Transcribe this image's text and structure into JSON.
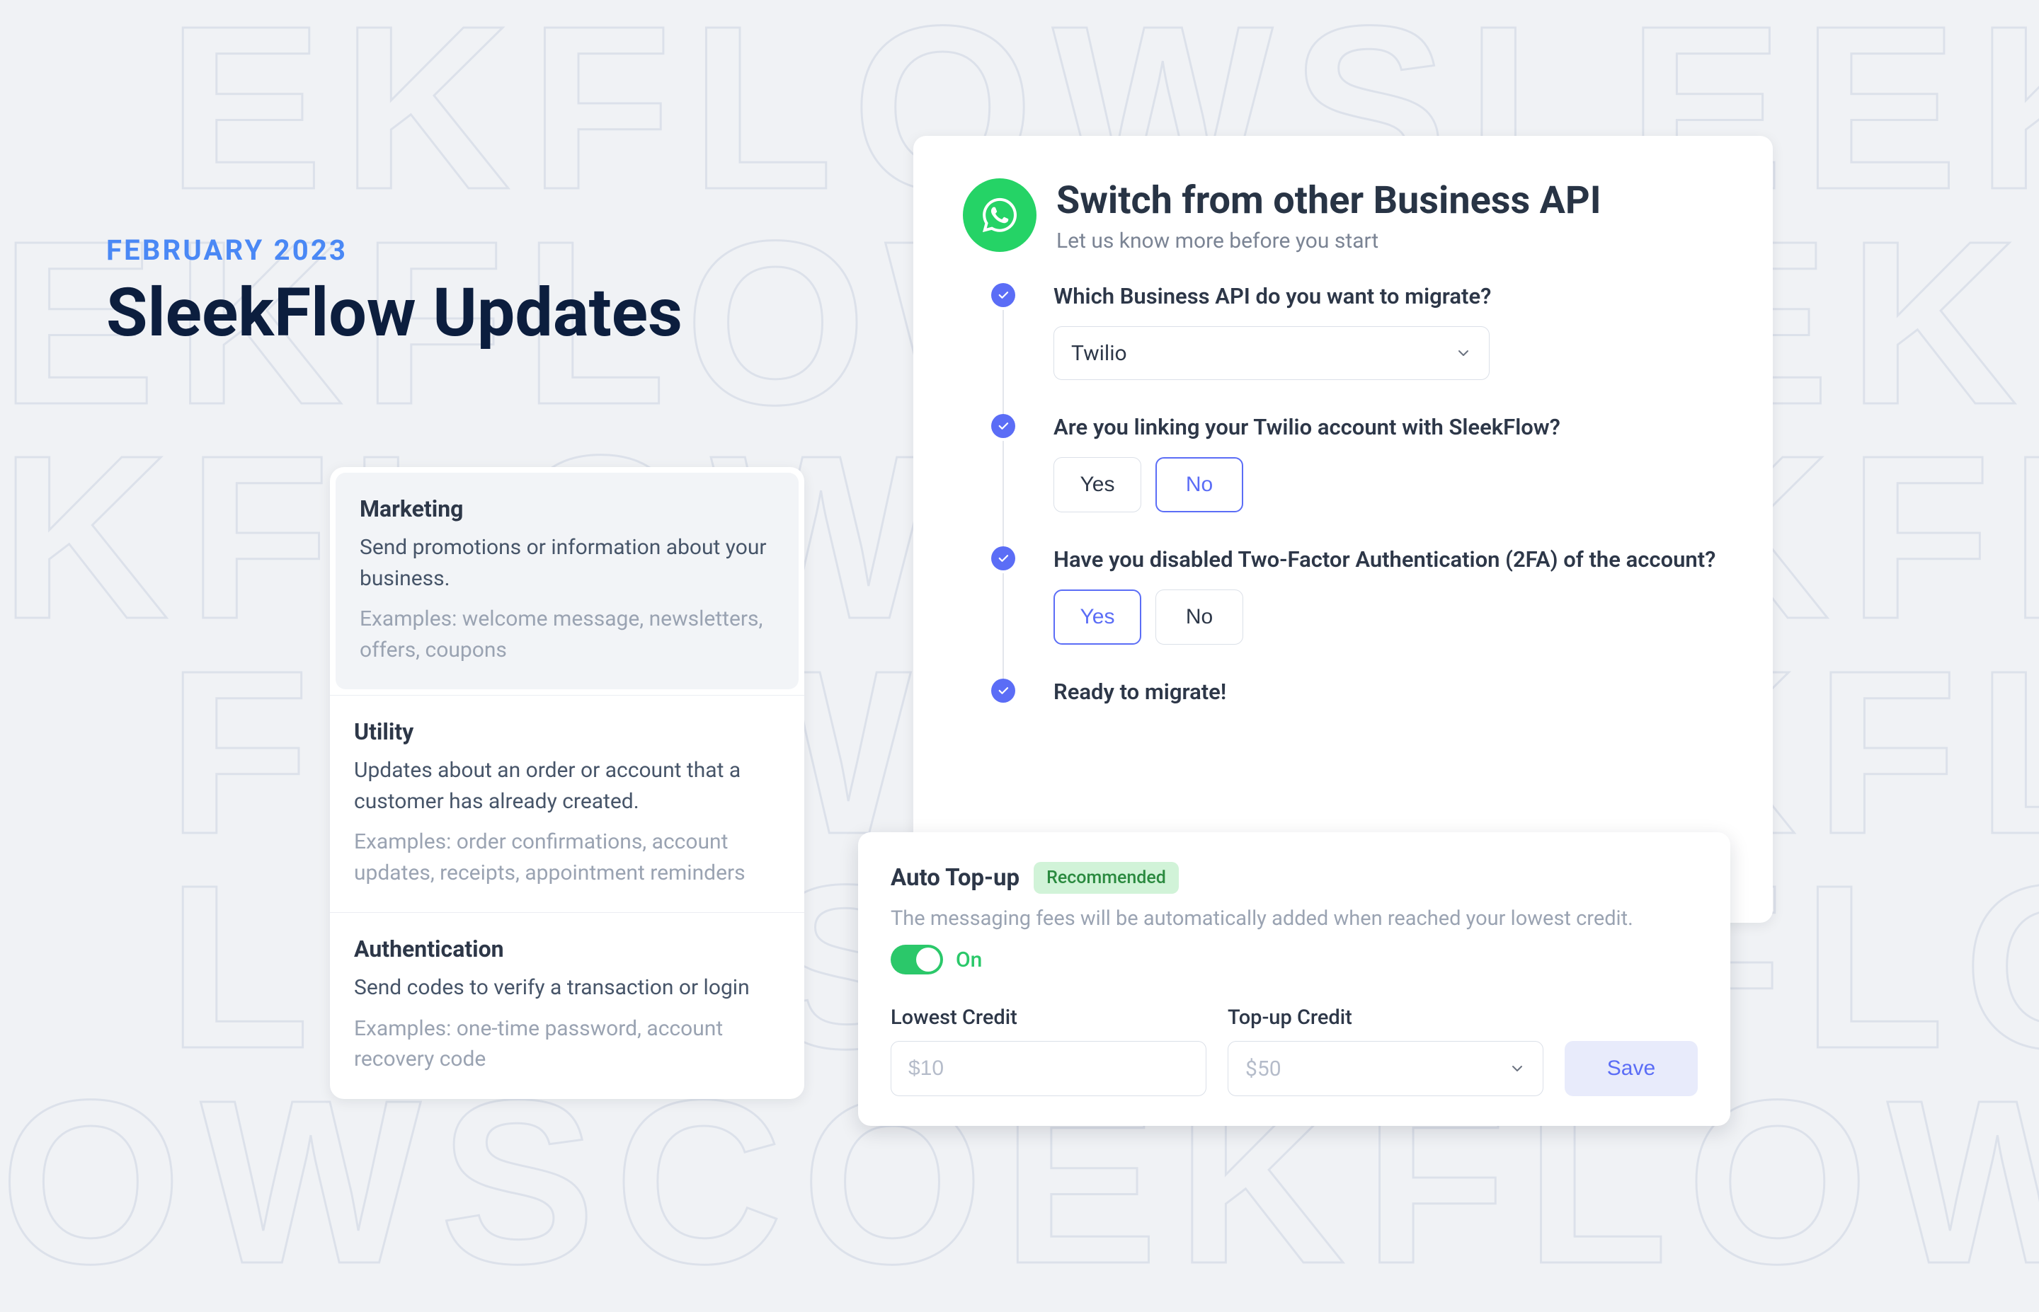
{
  "header": {
    "eyebrow": "FEBRUARY 2023",
    "title": "SleekFlow Updates"
  },
  "categories": [
    {
      "name": "Marketing",
      "desc": "Send promotions or information about your business.",
      "examples": "Examples: welcome message, newsletters, offers, coupons",
      "selected": true
    },
    {
      "name": "Utility",
      "desc": "Updates about an order or account that a customer has already created.",
      "examples": "Examples: order confirmations, account updates, receipts, appointment reminders",
      "selected": false
    },
    {
      "name": "Authentication",
      "desc": "Send codes to verify a transaction or login",
      "examples": "Examples: one-time password, account recovery code",
      "selected": false
    }
  ],
  "wizard": {
    "title": "Switch from other Business API",
    "subtitle": "Let us know more before you start",
    "steps": {
      "s1": {
        "label": "Which Business API do you want to migrate?",
        "value": "Twilio"
      },
      "s2": {
        "label": "Are you linking your Twilio account with SleekFlow?",
        "yes": "Yes",
        "no": "No",
        "selected": "no"
      },
      "s3": {
        "label": "Have you disabled Two-Factor Authentication (2FA) of the account?",
        "yes": "Yes",
        "no": "No",
        "selected": "yes"
      },
      "s4": {
        "label": "Ready to migrate!"
      }
    }
  },
  "topup": {
    "title": "Auto Top-up",
    "badge": "Recommended",
    "desc": "The messaging fees will be automatically added when reached your lowest credit.",
    "toggle_label": "On",
    "lowest_label": "Lowest Credit",
    "lowest_placeholder": "$10",
    "topup_label": "Top-up Credit",
    "topup_placeholder": "$50",
    "save": "Save"
  },
  "bg_text": "  EKFLOWSLEEKFLOWSLE\nEKFLOWSOEEKFLOWSLEE\nKFLOWSCEEKFLOWSLEEK\n  FLOWSEEEKFLOWSLEEKF\n  LOWSFEEKFLOWSLEEKFL\nOWSCOEKFLOWSLEEKFLO"
}
